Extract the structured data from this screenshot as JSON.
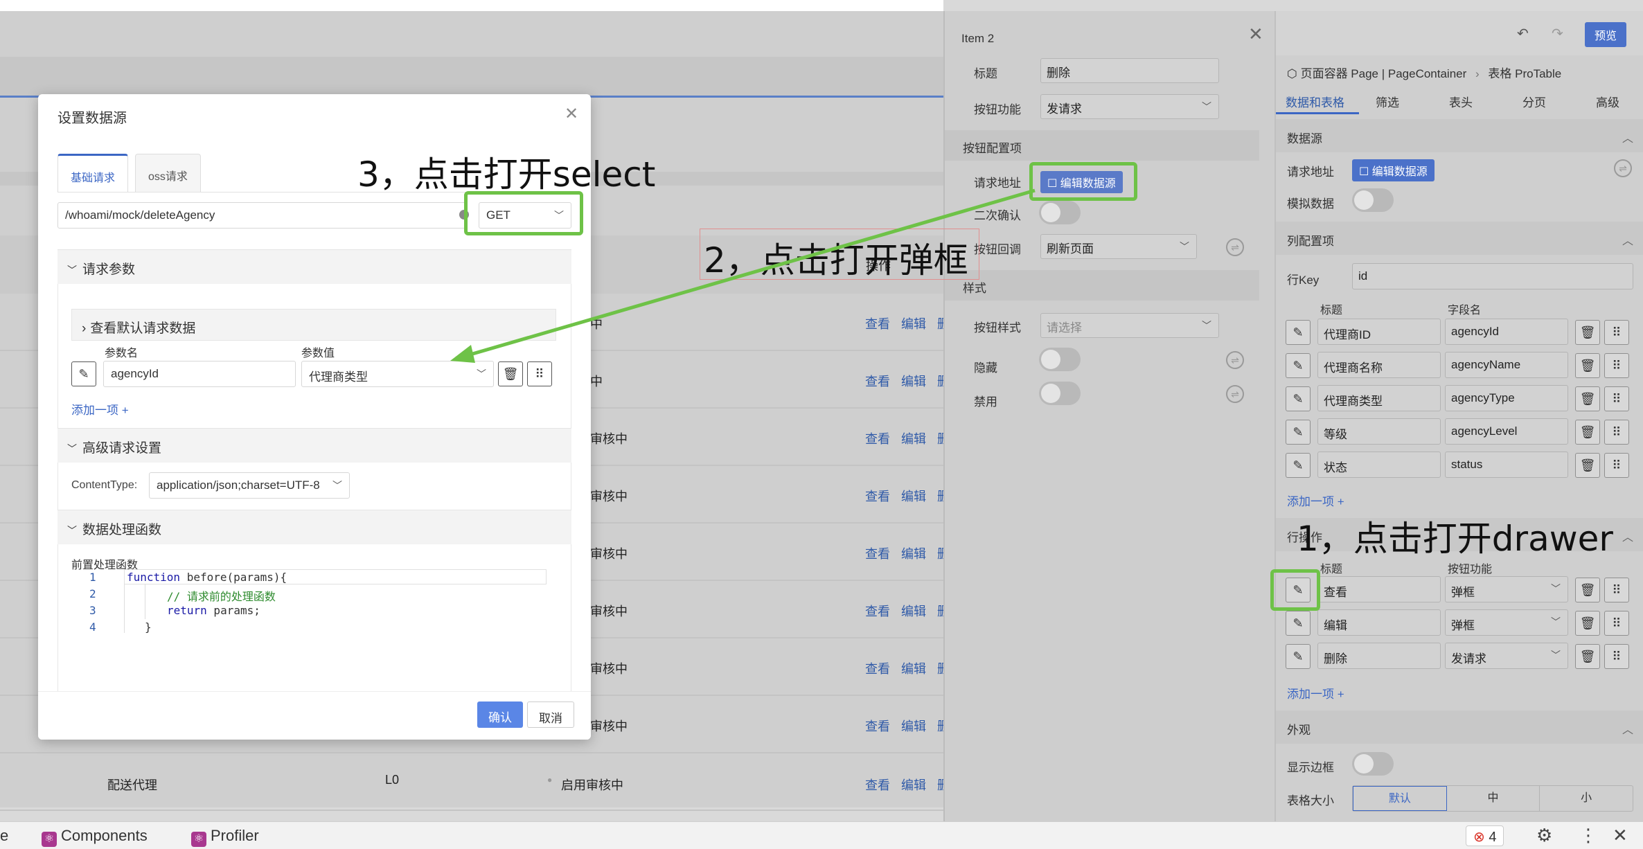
{
  "background": {
    "header_col": "操作",
    "rows": [
      {
        "status": "审核中",
        "actions": [
          "查看",
          "编辑",
          "删"
        ]
      },
      {
        "status": "审核中",
        "actions": [
          "查看",
          "编辑",
          "删"
        ]
      },
      {
        "status": "审核中",
        "actions": [
          "查看",
          "编辑",
          "删"
        ]
      },
      {
        "status": "审核中",
        "actions": [
          "查看",
          "编辑",
          "删"
        ]
      },
      {
        "status": "审核中",
        "actions": [
          "查看",
          "编辑",
          "删"
        ]
      },
      {
        "status": "审核中",
        "actions": [
          "查看",
          "编辑",
          "删"
        ]
      },
      {
        "status": "审核中",
        "actions": [
          "查看",
          "编辑",
          "删"
        ]
      },
      {
        "status": "审核中",
        "actions": [
          "查看",
          "编辑",
          "删"
        ]
      }
    ],
    "last_row": {
      "name": "配送代理",
      "level": "L0",
      "status": "启用审核中",
      "actions": [
        "查看",
        "编辑",
        "删"
      ]
    },
    "status_partial": [
      "中",
      "中",
      "审核中",
      "审核中",
      "审核中",
      "审核中",
      "审核中",
      "审核中"
    ]
  },
  "drawer": {
    "title": "Item 2",
    "fields": {
      "title_label": "标题",
      "title_value": "删除",
      "func_label": "按钮功能",
      "func_value": "发请求",
      "config_section": "按钮配置项",
      "url_label": "请求地址",
      "url_button": "编辑数据源",
      "confirm_label": "二次确认",
      "callback_label": "按钮回调",
      "callback_value": "刷新页面",
      "style_section": "样式",
      "style_label": "按钮样式",
      "style_placeholder": "请选择",
      "hidden_label": "隐藏",
      "disabled_label": "禁用"
    }
  },
  "panel": {
    "preview_button": "预览",
    "breadcrumb": [
      "页面容器 Page | PageContainer",
      "表格 ProTable"
    ],
    "tabs": [
      "数据和表格",
      "筛选",
      "表头",
      "分页",
      "高级"
    ],
    "datasource_section": "数据源",
    "request_url_label": "请求地址",
    "edit_datasource": "编辑数据源",
    "mock_label": "模拟数据",
    "column_section": "列配置项",
    "rowkey_label": "行Key",
    "rowkey_value": "id",
    "col_head_title": "标题",
    "col_head_field": "字段名",
    "columns": [
      {
        "title": "代理商ID",
        "field": "agencyId"
      },
      {
        "title": "代理商名称",
        "field": "agencyName"
      },
      {
        "title": "代理商类型",
        "field": "agencyType"
      },
      {
        "title": "等级",
        "field": "agencyLevel"
      },
      {
        "title": "状态",
        "field": "status"
      }
    ],
    "add_item": "添加一项 +",
    "row_action_section": "行操作",
    "action_head_title": "标题",
    "action_head_func": "按钮功能",
    "actions": [
      {
        "title": "查看",
        "func": "弹框"
      },
      {
        "title": "编辑",
        "func": "弹框"
      },
      {
        "title": "删除",
        "func": "发请求"
      }
    ],
    "appearance_section": "外观",
    "border_label": "显示边框",
    "size_label": "表格大小",
    "sizes": [
      "默认",
      "中",
      "小"
    ]
  },
  "modal": {
    "title": "设置数据源",
    "tabs": [
      "基础请求",
      "oss请求"
    ],
    "url_value": "/whoami/mock/deleteAgency",
    "method_value": "GET",
    "params_section": "请求参数",
    "view_default": "查看默认请求数据",
    "param_name_head": "参数名",
    "param_value_head": "参数值",
    "param_name": "agencyId",
    "param_value": "代理商类型",
    "add_item": "添加一项 +",
    "advanced_section": "高级请求设置",
    "content_type_label": "ContentType:",
    "content_type_value": "application/json;charset=UTF-8",
    "processing_section": "数据处理函数",
    "preprocess_label": "前置处理函数",
    "code": [
      {
        "no": "1",
        "text": "function before(params){"
      },
      {
        "no": "2",
        "text": "// 请求前的处理函数"
      },
      {
        "no": "3",
        "text": "return params;"
      },
      {
        "no": "4",
        "text": "}"
      }
    ],
    "confirm": "确认",
    "cancel": "取消"
  },
  "annotations": {
    "step1": "1，点击打开drawer",
    "step2": "2，点击打开弹框",
    "step3": "3，点击打开select"
  },
  "devtools": {
    "left_partial": "e",
    "components": "Components",
    "profiler": "Profiler",
    "error_count": "4"
  },
  "colors": {
    "accent": "#4b71c9",
    "highlight": "#6ec247",
    "link": "#3b66c4"
  }
}
